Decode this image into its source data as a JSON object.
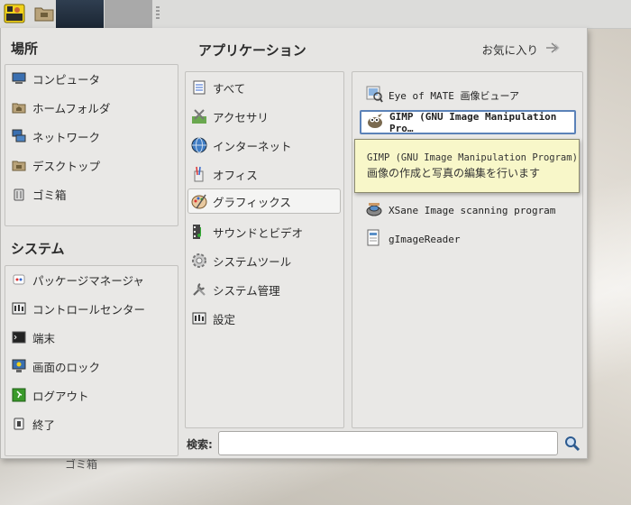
{
  "desktop": {
    "trash_label": "ゴミ箱"
  },
  "places": {
    "heading": "場所",
    "items": [
      {
        "label": "コンピュータ",
        "icon": "computer-icon"
      },
      {
        "label": "ホームフォルダ",
        "icon": "home-folder-icon"
      },
      {
        "label": "ネットワーク",
        "icon": "network-icon"
      },
      {
        "label": "デスクトップ",
        "icon": "desktop-folder-icon"
      },
      {
        "label": "ゴミ箱",
        "icon": "trash-icon"
      }
    ]
  },
  "system": {
    "heading": "システム",
    "items": [
      {
        "label": "パッケージマネージャ",
        "icon": "package-manager-icon"
      },
      {
        "label": "コントロールセンター",
        "icon": "control-center-icon"
      },
      {
        "label": "端末",
        "icon": "terminal-icon"
      },
      {
        "label": "画面のロック",
        "icon": "lock-screen-icon"
      },
      {
        "label": "ログアウト",
        "icon": "logout-icon"
      },
      {
        "label": "終了",
        "icon": "shutdown-icon"
      }
    ]
  },
  "applications": {
    "heading": "アプリケーション",
    "favorites_label": "お気に入り",
    "categories": [
      {
        "label": "すべて",
        "icon": "all-apps-icon"
      },
      {
        "label": "アクセサリ",
        "icon": "accessories-icon"
      },
      {
        "label": "インターネット",
        "icon": "internet-globe-icon"
      },
      {
        "label": "オフィス",
        "icon": "office-icon"
      },
      {
        "label": "グラフィックス",
        "icon": "graphics-icon",
        "selected": true
      },
      {
        "label": "サウンドとビデオ",
        "icon": "sound-video-icon"
      },
      {
        "label": "システムツール",
        "icon": "system-tools-icon"
      },
      {
        "label": "システム管理",
        "icon": "system-admin-icon"
      },
      {
        "label": "設定",
        "icon": "settings-icon"
      }
    ],
    "apps": [
      {
        "label": "Eye of MATE 画像ビューア",
        "icon": "image-viewer-icon"
      },
      {
        "label": "GIMP (GNU Image Manipulation Pro…",
        "icon": "gimp-icon",
        "selected": true
      },
      {
        "label": "XSane Image scanning program",
        "icon": "xsane-icon"
      },
      {
        "label": "gImageReader",
        "icon": "gimagereader-icon"
      }
    ]
  },
  "tooltip": {
    "line1": "GIMP (GNU Image Manipulation Program)",
    "line2": "画像の作成と写真の編集を行います"
  },
  "search": {
    "label": "検索:",
    "value": "",
    "placeholder": ""
  }
}
